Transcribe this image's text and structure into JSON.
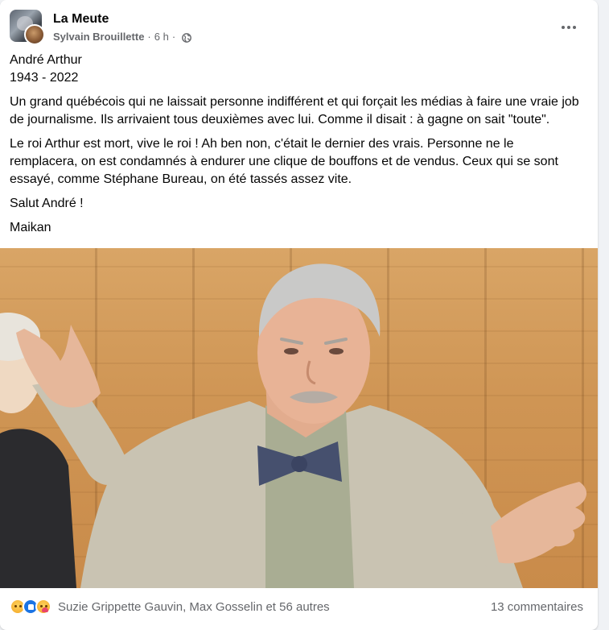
{
  "post": {
    "group_name": "La Meute",
    "author": "Sylvain Brouillette",
    "time": "6 h",
    "privacy_icon": "globe-icon",
    "more_icon": "more-options-icon",
    "text": {
      "line1": "André Arthur",
      "line2": "1943 - 2022",
      "paragraph1": "Un grand québécois qui ne laissait personne indifférent et qui forçait les médias à faire une vraie job de journalisme. Ils arrivaient tous deuxièmes avec lui. Comme il disait : à gagne on sait \"toute\".",
      "paragraph2": "Le roi Arthur est mort, vive le roi ! Ah ben non, c'était le dernier des vrais. Personne ne le remplacera, on est condamnés à endurer une clique de bouffons et de vendus. Ceux qui se sont essayé, comme Stéphane Bureau, on été tassés assez vite.",
      "paragraph3": "Salut André !",
      "paragraph4": "Maikan"
    }
  },
  "footer": {
    "reaction_icons": [
      "sad-reaction-icon",
      "like-reaction-icon",
      "care-reaction-icon"
    ],
    "reactors_text": "Suzie Grippette Gauvin, Max Gosselin et 56 autres",
    "comments_text": "13 commentaires"
  },
  "colors": {
    "card_bg": "#ffffff",
    "page_bg": "#f0f2f5",
    "secondary_text": "#65676b",
    "like_blue": "#1b74e4"
  }
}
